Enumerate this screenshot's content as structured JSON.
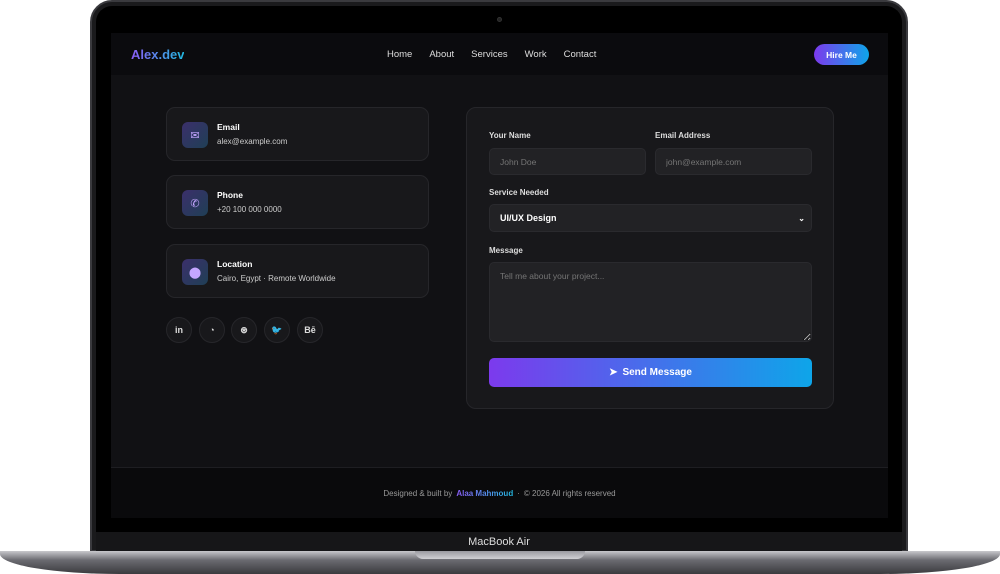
{
  "device": {
    "label": "MacBook Air"
  },
  "nav": {
    "logo": "Alex.dev",
    "links": [
      "Home",
      "About",
      "Services",
      "Work",
      "Contact"
    ],
    "cta": "Hire Me"
  },
  "contact_cards": [
    {
      "title": "Email",
      "value": "alex@example.com",
      "icon": "envelope-icon"
    },
    {
      "title": "Phone",
      "value": "+20 100 000 0000",
      "icon": "phone-icon"
    },
    {
      "title": "Location",
      "value": "Cairo, Egypt · Remote Worldwide",
      "icon": "map-pin-icon"
    }
  ],
  "social": [
    {
      "name": "linkedin",
      "glyph": "in"
    },
    {
      "name": "github",
      "glyph": "◔"
    },
    {
      "name": "dribbble",
      "glyph": "⊛"
    },
    {
      "name": "twitter",
      "glyph": "🐦"
    },
    {
      "name": "behance",
      "glyph": "Bē"
    }
  ],
  "form": {
    "name_label": "Your Name",
    "name_placeholder": "John Doe",
    "email_label": "Email Address",
    "email_placeholder": "john@example.com",
    "service_label": "Service Needed",
    "service_value": "UI/UX Design",
    "message_label": "Message",
    "message_placeholder": "Tell me about your project...",
    "submit": "Send Message"
  },
  "footer": {
    "prefix": "Designed & built by",
    "author": "Alaa Mahmoud",
    "sep": "·",
    "copyright": "© 2026 All rights reserved"
  }
}
